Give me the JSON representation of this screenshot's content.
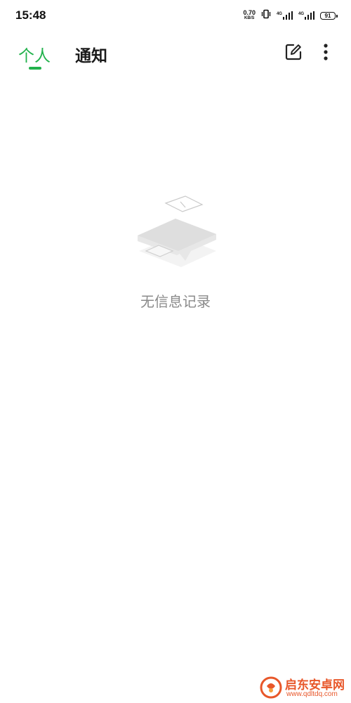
{
  "status_bar": {
    "time": "15:48",
    "net_speed_value": "0.70",
    "net_speed_unit": "KB/S",
    "signal_1_tag": "4G",
    "signal_2_tag": "4G",
    "battery": "91"
  },
  "header": {
    "tabs": [
      {
        "label": "个人",
        "active": true
      },
      {
        "label": "通知",
        "active": false
      }
    ],
    "edit_icon": "edit-icon",
    "more_icon": "more-vertical-icon",
    "accent_color": "#22b24c"
  },
  "empty_state": {
    "message": "无信息记录",
    "illustration": "empty-messages-illustration"
  },
  "watermark": {
    "name": "启东安卓网",
    "url": "www.qdltdq.com"
  }
}
